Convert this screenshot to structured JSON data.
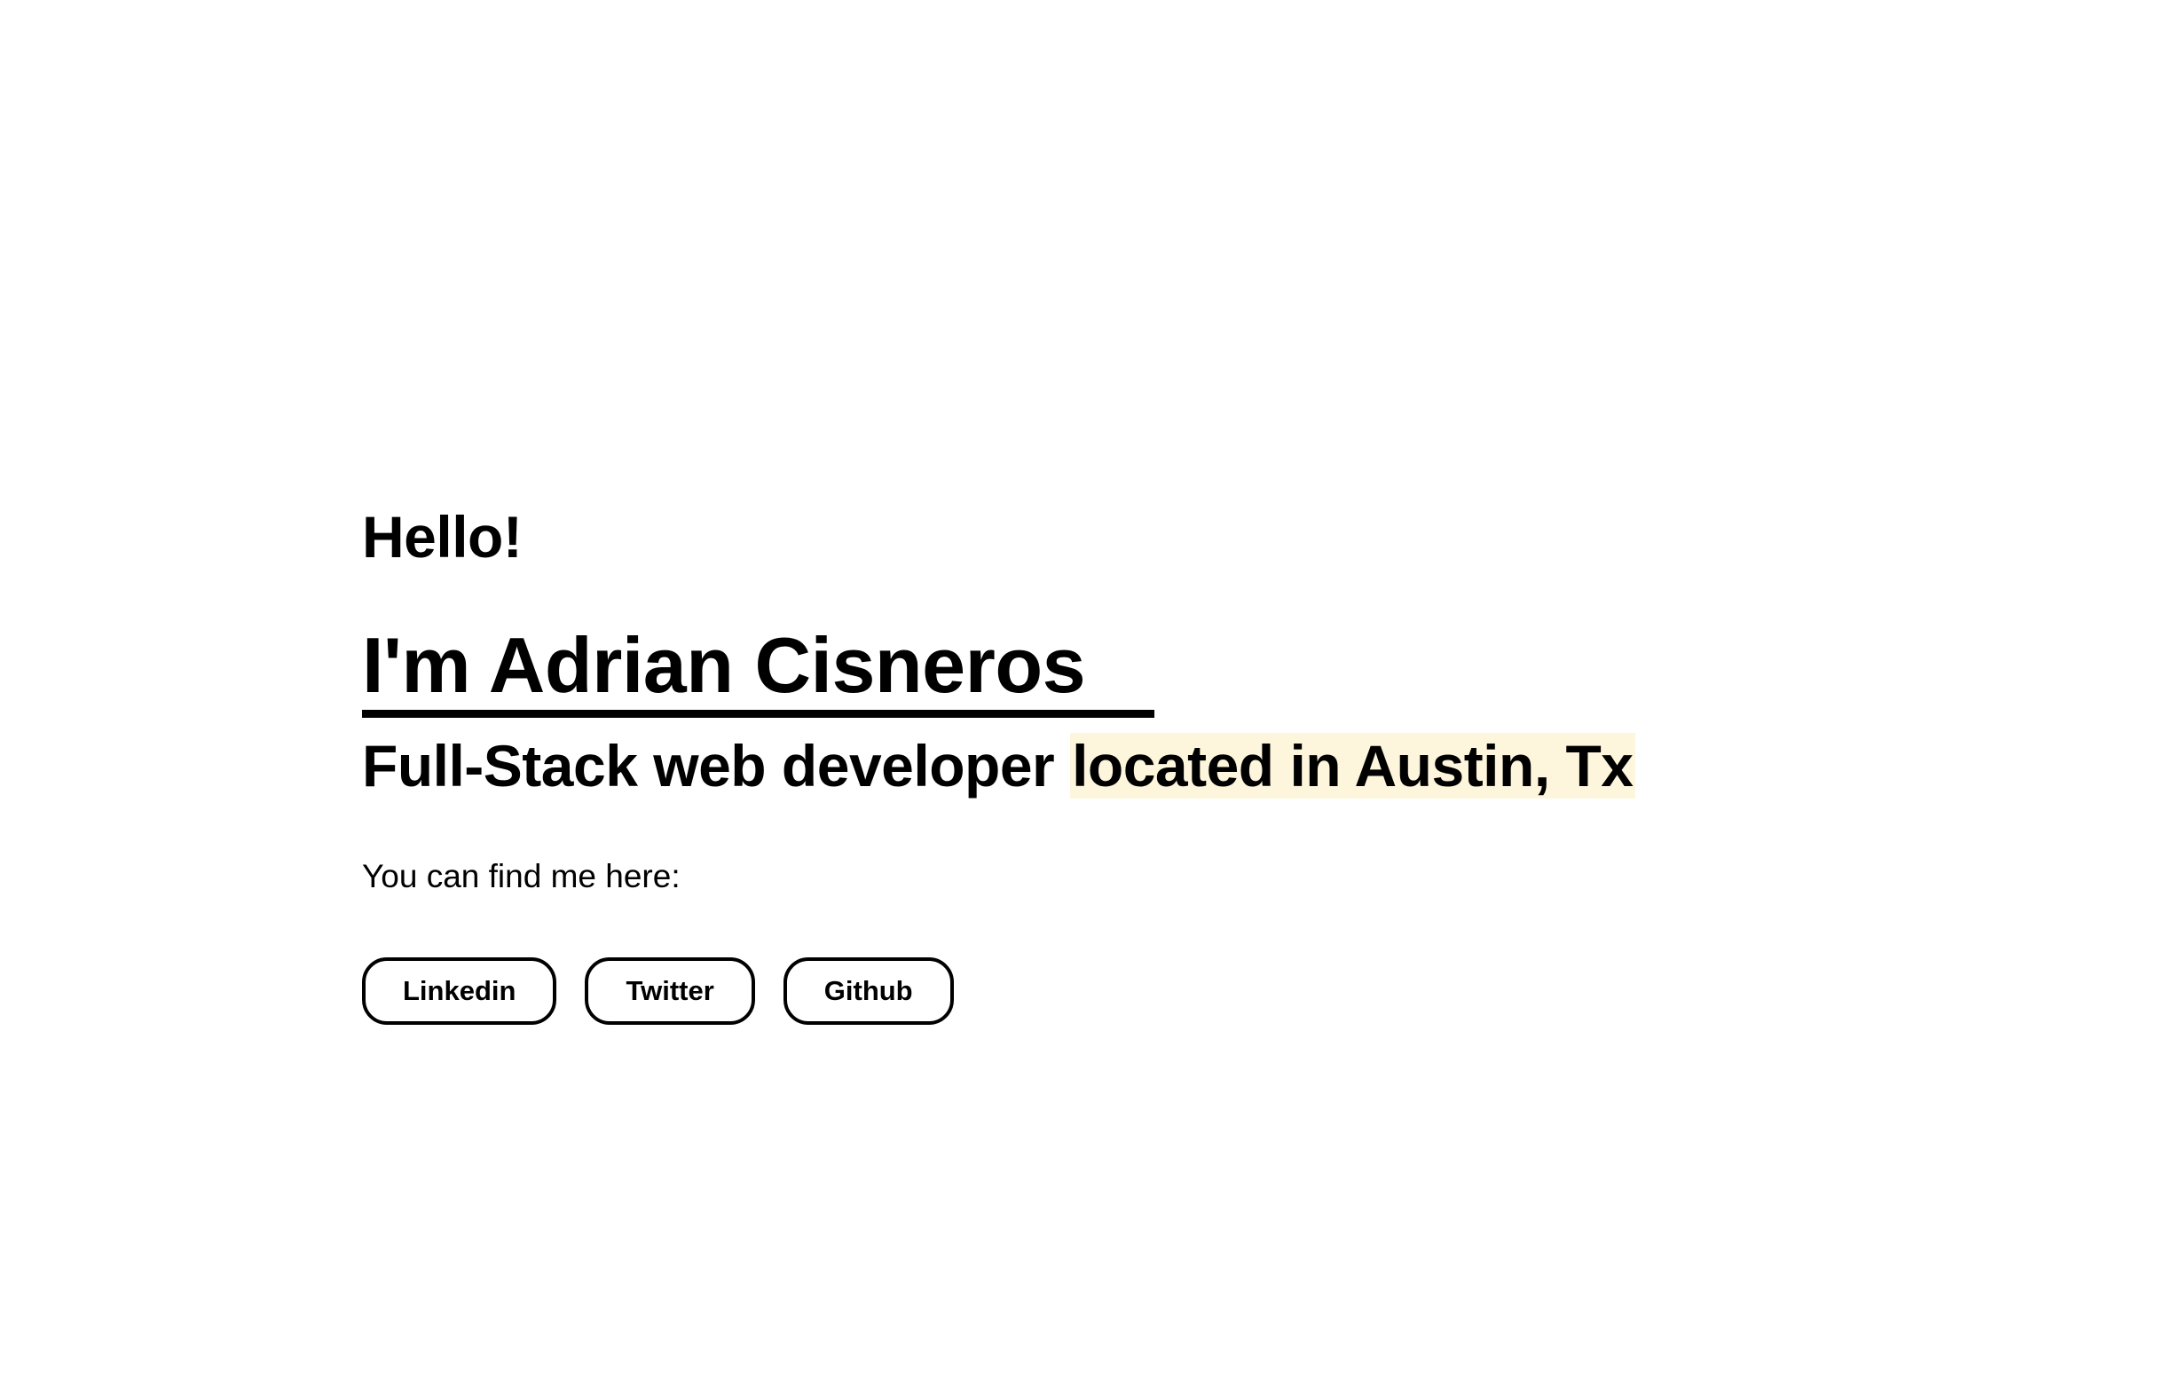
{
  "hero": {
    "greeting": "Hello!",
    "name": "I'm Adrian Cisneros",
    "tagline_prefix": "Full-Stack web developer ",
    "tagline_highlight": "located in Austin, Tx",
    "find_text": "You can find me here:"
  },
  "socials": {
    "linkedin_label": "Linkedin",
    "twitter_label": "Twitter",
    "github_label": "Github"
  },
  "colors": {
    "background": "#ffffff",
    "text": "#000000",
    "highlight": "#fdf5dc"
  }
}
